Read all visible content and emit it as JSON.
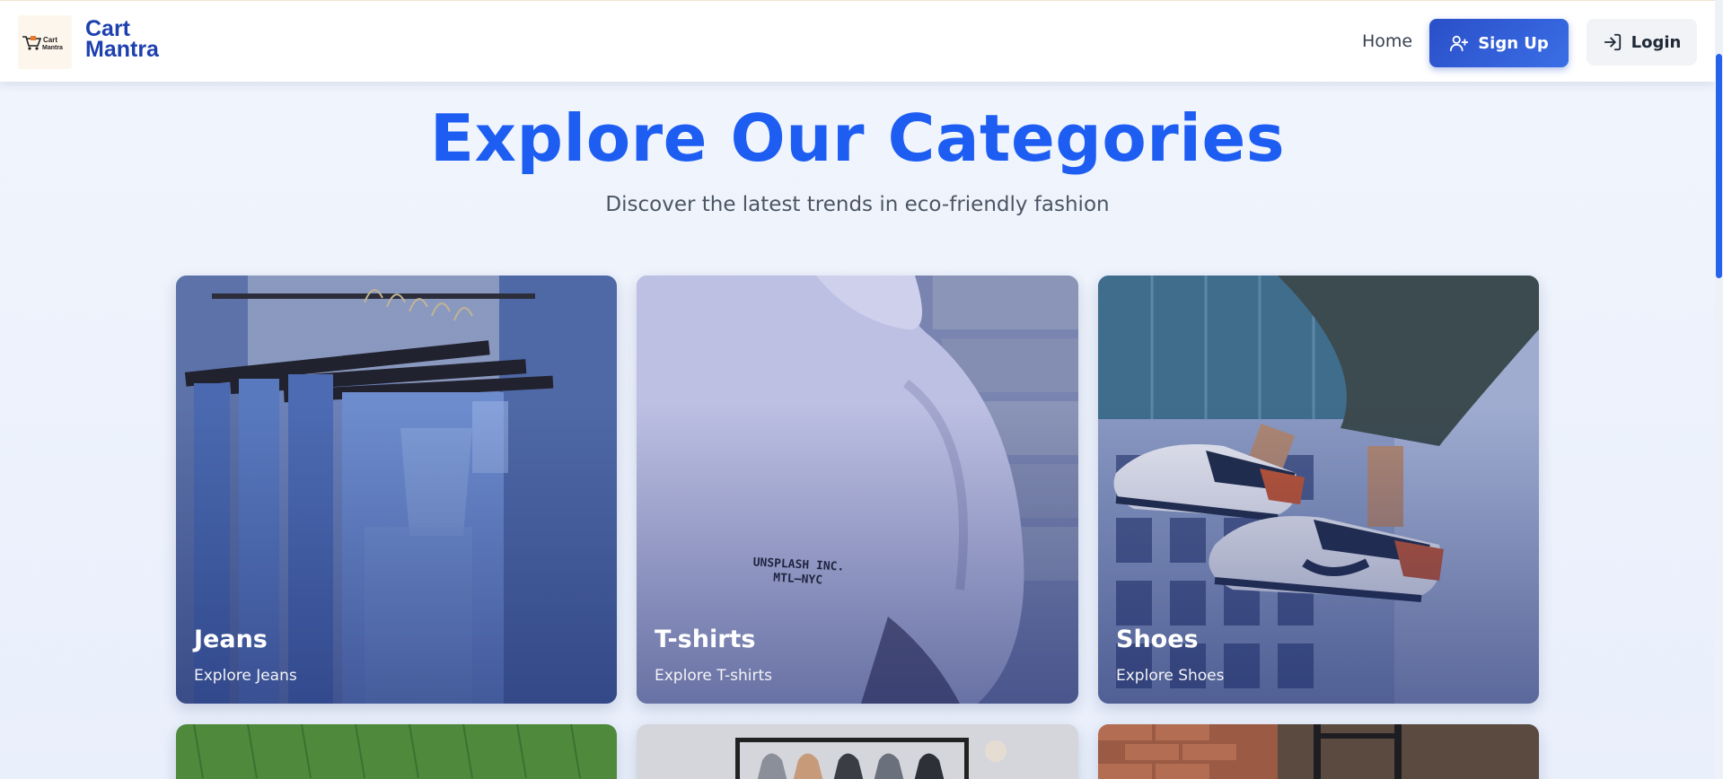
{
  "brand": {
    "line1": "Cart",
    "line2": "Mantra",
    "logo_text1": "Cart",
    "logo_text2": "Mantra"
  },
  "nav": {
    "home_label": "Home",
    "signup_label": "Sign Up",
    "login_label": "Login",
    "signup_icon": "user-plus-icon",
    "login_icon": "log-in-icon"
  },
  "hero": {
    "title": "Explore Our Categories",
    "subtitle": "Discover the latest trends in eco-friendly fashion"
  },
  "categories": [
    {
      "title": "Jeans",
      "subtitle": "Explore Jeans"
    },
    {
      "title": "T-shirts",
      "subtitle": "Explore T-shirts",
      "shirt_print_line1": "UNSPLASH INC.",
      "shirt_print_line2": "MTL—NYC"
    },
    {
      "title": "Shoes",
      "subtitle": "Explore Shoes"
    }
  ],
  "colors": {
    "accent": "#1d5df2",
    "brand": "#1e40af",
    "signup_bg": "#2a4fc8"
  }
}
